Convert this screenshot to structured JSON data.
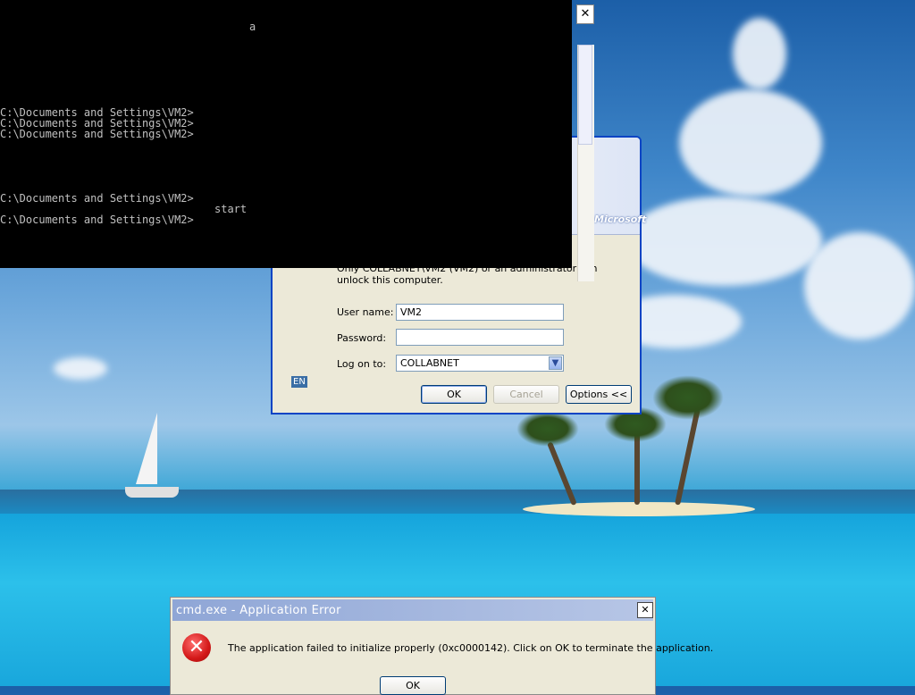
{
  "cmd": {
    "lines": [
      "a",
      "C:\\Documents and Settings\\VM2>",
      "C:\\Documents and Settings\\VM2>",
      "C:\\Documents and Settings\\VM2>",
      "C:\\Documents and Settings\\VM2>",
      "start",
      "C:\\Documents and Settings\\VM2>"
    ],
    "close_label": "✕"
  },
  "logon": {
    "brand": "Microsoft",
    "message": "Only COLLABNET\\VM2 (VM2) or an administrator can unlock this computer.",
    "fields": {
      "username_label": "User name:",
      "username_value": "VM2",
      "password_label": "Password:",
      "password_value": "",
      "logon_label": "Log on to:",
      "logon_value": "COLLABNET"
    },
    "language": "EN",
    "buttons": {
      "ok": "OK",
      "cancel": "Cancel",
      "options": "Options <<"
    }
  },
  "error": {
    "title": "cmd.exe - Application Error",
    "message": "The application failed to initialize properly (0xc0000142). Click on OK to terminate the application.",
    "ok": "OK",
    "icon": "error-icon",
    "close_label": "✕"
  }
}
